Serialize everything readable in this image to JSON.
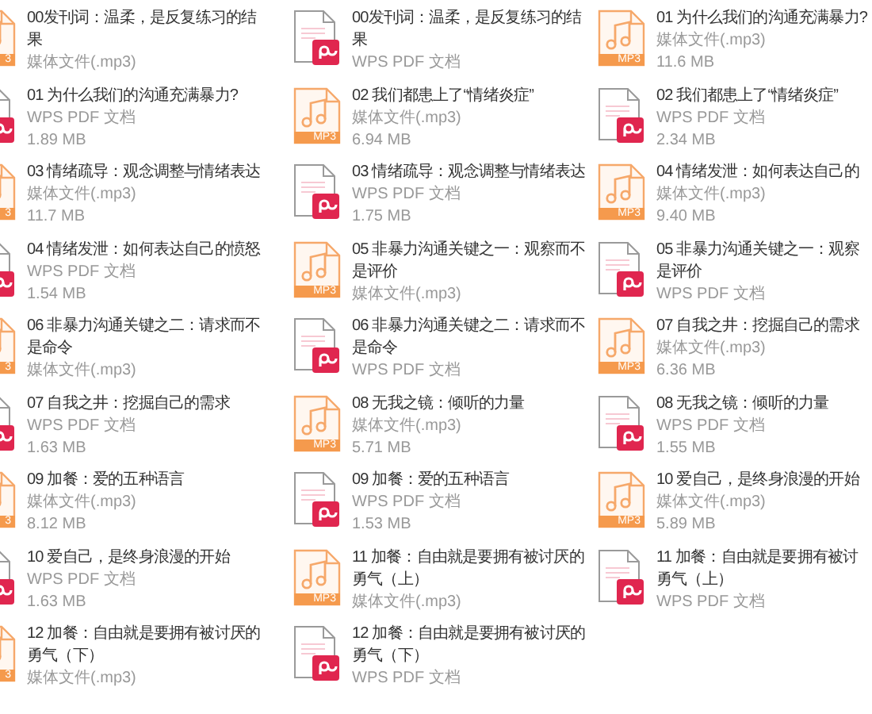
{
  "files": [
    {
      "kind": "mp3",
      "badge": "3",
      "title_lines": [
        "00发刊词：温柔，是反复练习的结",
        "果"
      ],
      "type": "媒体文件(.mp3)"
    },
    {
      "kind": "pdf",
      "title_lines": [
        "00发刊词：温柔，是反复练习的结",
        "果"
      ],
      "type": "WPS PDF 文档"
    },
    {
      "kind": "mp3",
      "badge": "MP3",
      "title_lines": [
        "01 为什么我们的沟通充满暴力?"
      ],
      "type": "媒体文件(.mp3)",
      "size": "11.6 MB"
    },
    {
      "kind": "pdf",
      "title_lines": [
        "01 为什么我们的沟通充满暴力?"
      ],
      "type": "WPS PDF 文档",
      "size": "1.89 MB"
    },
    {
      "kind": "mp3",
      "badge": "MP3",
      "title_lines": [
        "02 我们都患上了“情绪炎症”"
      ],
      "type": "媒体文件(.mp3)",
      "size": "6.94 MB"
    },
    {
      "kind": "pdf",
      "title_lines": [
        "02 我们都患上了“情绪炎症”"
      ],
      "type": "WPS PDF 文档",
      "size": "2.34 MB"
    },
    {
      "kind": "mp3",
      "badge": "3",
      "title_lines": [
        "03 情绪疏导：观念调整与情绪表达"
      ],
      "type": "媒体文件(.mp3)",
      "size": "11.7 MB"
    },
    {
      "kind": "pdf",
      "title_lines": [
        "03 情绪疏导：观念调整与情绪表达"
      ],
      "type": "WPS PDF 文档",
      "size": "1.75 MB"
    },
    {
      "kind": "mp3",
      "badge": "MP3",
      "title_lines": [
        "04 情绪发泄：如何表达自己的"
      ],
      "type": "媒体文件(.mp3)",
      "size": "9.40 MB"
    },
    {
      "kind": "pdf",
      "title_lines": [
        "04 情绪发泄：如何表达自己的愤怒"
      ],
      "type": "WPS PDF 文档",
      "size": "1.54 MB"
    },
    {
      "kind": "mp3",
      "badge": "MP3",
      "title_lines": [
        "05 非暴力沟通关键之一：观察而不",
        "是评价"
      ],
      "type": "媒体文件(.mp3)"
    },
    {
      "kind": "pdf",
      "title_lines": [
        "05 非暴力沟通关键之一：观察",
        "是评价"
      ],
      "type": "WPS PDF 文档"
    },
    {
      "kind": "mp3",
      "badge": "3",
      "title_lines": [
        "06 非暴力沟通关键之二：请求而不",
        "是命令"
      ],
      "type": "媒体文件(.mp3)"
    },
    {
      "kind": "pdf",
      "title_lines": [
        "06 非暴力沟通关键之二：请求而不",
        "是命令"
      ],
      "type": "WPS PDF 文档"
    },
    {
      "kind": "mp3",
      "badge": "MP3",
      "title_lines": [
        "07 自我之井：挖掘自己的需求"
      ],
      "type": "媒体文件(.mp3)",
      "size": "6.36 MB"
    },
    {
      "kind": "pdf",
      "title_lines": [
        "07 自我之井：挖掘自己的需求"
      ],
      "type": "WPS PDF 文档",
      "size": "1.63 MB"
    },
    {
      "kind": "mp3",
      "badge": "MP3",
      "title_lines": [
        "08 无我之镜：倾听的力量"
      ],
      "type": "媒体文件(.mp3)",
      "size": "5.71 MB"
    },
    {
      "kind": "pdf",
      "title_lines": [
        "08 无我之镜：倾听的力量"
      ],
      "type": "WPS PDF 文档",
      "size": "1.55 MB"
    },
    {
      "kind": "mp3",
      "badge": "3",
      "title_lines": [
        "09 加餐：爱的五种语言"
      ],
      "type": "媒体文件(.mp3)",
      "size": "8.12 MB"
    },
    {
      "kind": "pdf",
      "title_lines": [
        "09 加餐：爱的五种语言"
      ],
      "type": "WPS PDF 文档",
      "size": "1.53 MB"
    },
    {
      "kind": "mp3",
      "badge": "MP3",
      "title_lines": [
        "10 爱自己，是终身浪漫的开始"
      ],
      "type": "媒体文件(.mp3)",
      "size": "5.89 MB"
    },
    {
      "kind": "pdf",
      "title_lines": [
        "10 爱自己，是终身浪漫的开始"
      ],
      "type": "WPS PDF 文档",
      "size": "1.63 MB"
    },
    {
      "kind": "mp3",
      "badge": "MP3",
      "title_lines": [
        "11 加餐：自由就是要拥有被讨厌的",
        "勇气（上）"
      ],
      "type": "媒体文件(.mp3)"
    },
    {
      "kind": "pdf",
      "title_lines": [
        "11 加餐：自由就是要拥有被讨",
        "勇气（上）"
      ],
      "type": "WPS PDF 文档"
    },
    {
      "kind": "mp3",
      "badge": "3",
      "title_lines": [
        "12 加餐：自由就是要拥有被讨厌的",
        "勇气（下）"
      ],
      "type": "媒体文件(.mp3)"
    },
    {
      "kind": "pdf",
      "title_lines": [
        "12 加餐：自由就是要拥有被讨厌的",
        "勇气（下）"
      ],
      "type": "WPS PDF 文档"
    }
  ]
}
